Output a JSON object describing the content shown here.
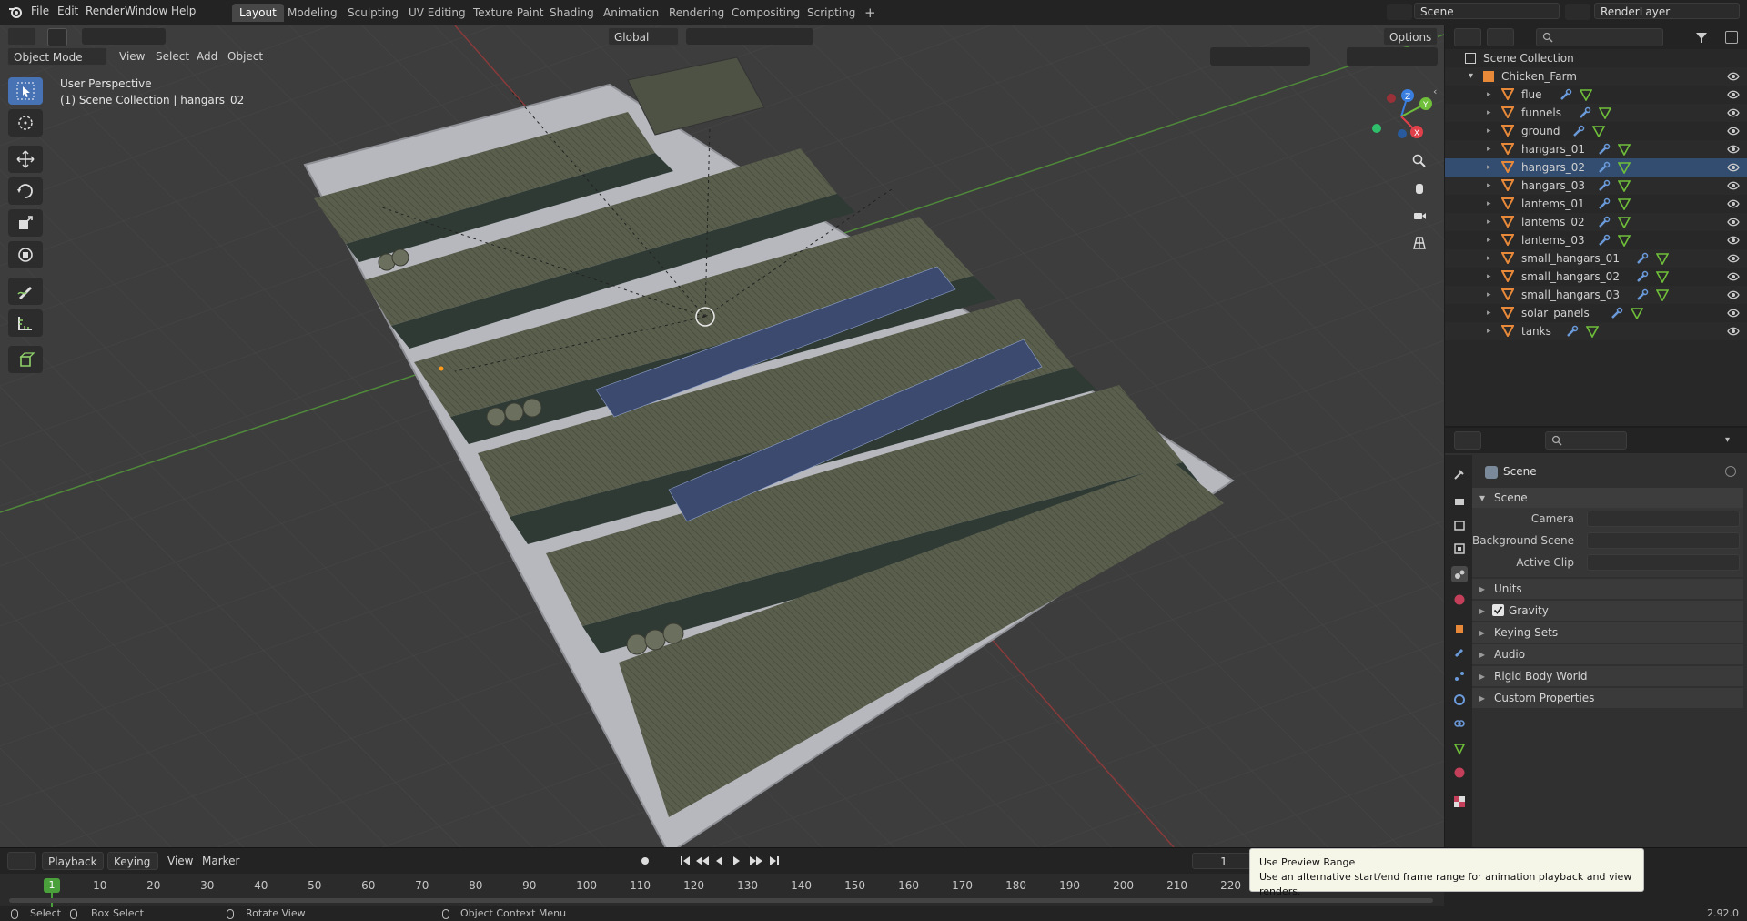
{
  "app": {
    "name": "Blender",
    "version": "2.92.0"
  },
  "top_menu": [
    "File",
    "Edit",
    "Render",
    "Window",
    "Help"
  ],
  "workspace_tabs": [
    {
      "label": "Layout",
      "active": true
    },
    {
      "label": "Modeling"
    },
    {
      "label": "Sculpting"
    },
    {
      "label": "UV Editing"
    },
    {
      "label": "Texture Paint"
    },
    {
      "label": "Shading"
    },
    {
      "label": "Animation"
    },
    {
      "label": "Rendering"
    },
    {
      "label": "Compositing"
    },
    {
      "label": "Scripting"
    }
  ],
  "scene_field": {
    "value": "Scene"
  },
  "view_layer_field": {
    "value": "RenderLayer"
  },
  "viewport_header": {
    "mode": "Object Mode",
    "menus": [
      "View",
      "Select",
      "Add",
      "Object"
    ],
    "orientation": "Global",
    "options_label": "Options"
  },
  "viewport_overlay": {
    "view_name": "User Perspective",
    "context": "(1) Scene Collection | hangars_02"
  },
  "gizmo": {
    "x": "X",
    "y": "Y",
    "z": "Z"
  },
  "outliner": {
    "root": "Scene Collection",
    "collection": "Chicken_Farm",
    "objects": [
      {
        "name": "flue"
      },
      {
        "name": "funnels"
      },
      {
        "name": "ground"
      },
      {
        "name": "hangars_01"
      },
      {
        "name": "hangars_02",
        "selected": true
      },
      {
        "name": "hangars_03"
      },
      {
        "name": "lantems_01"
      },
      {
        "name": "lantems_02"
      },
      {
        "name": "lantems_03"
      },
      {
        "name": "small_hangars_01"
      },
      {
        "name": "small_hangars_02"
      },
      {
        "name": "small_hangars_03"
      },
      {
        "name": "solar_panels"
      },
      {
        "name": "tanks"
      }
    ]
  },
  "properties": {
    "context_title": "Scene",
    "panel_title": "Scene",
    "camera_label": "Camera",
    "background_scene_label": "Background Scene",
    "active_clip_label": "Active Clip",
    "subpanels": [
      "Units",
      "Gravity",
      "Keying Sets",
      "Audio",
      "Rigid Body World",
      "Custom Properties"
    ],
    "gravity_checked": true
  },
  "timeline": {
    "menus": [
      "Playback",
      "Keying",
      "View",
      "Marker"
    ],
    "current_frame": "1",
    "frame_field": "1",
    "ruler": [
      "1",
      "10",
      "20",
      "30",
      "40",
      "50",
      "60",
      "70",
      "80",
      "90",
      "100",
      "110",
      "120",
      "130",
      "140",
      "150",
      "160",
      "170",
      "180",
      "190",
      "200",
      "210",
      "220"
    ]
  },
  "tooltip": {
    "title": "Use Preview Range",
    "body": "Use an alternative start/end frame range for animation playback and view renders."
  },
  "statusbar": {
    "select": "Select",
    "box_select": "Box Select",
    "rotate_view": "Rotate View",
    "context_menu": "Object Context Menu",
    "version": "2.92.0"
  },
  "colors": {
    "accent": "#4772b3",
    "object_icon": "#e8893a",
    "axis_x": "#e0404a",
    "axis_y": "#6fbf3a",
    "axis_z": "#3a7fe0"
  }
}
